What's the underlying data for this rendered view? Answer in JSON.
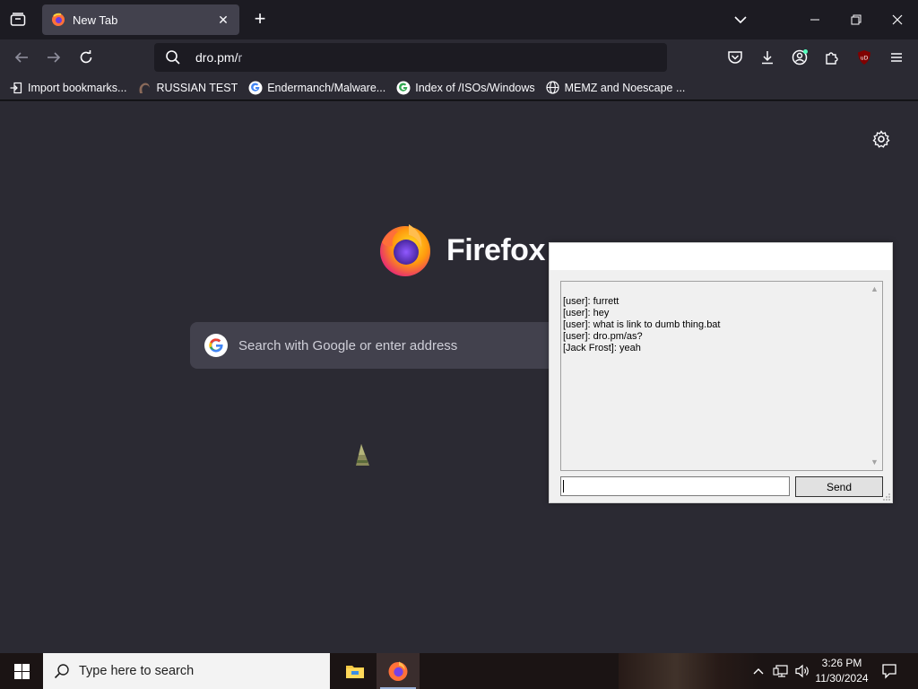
{
  "browser": {
    "tab": {
      "title": "New Tab"
    },
    "urlbar": {
      "value_host": "dro.pm/",
      "value_path": "r"
    },
    "bookmarks": [
      {
        "label": "Import bookmarks...",
        "icon": "import-icon"
      },
      {
        "label": "RUSSIAN TEST",
        "icon": "site-favicon"
      },
      {
        "label": "Endermanch/Malware...",
        "icon": "google-icon"
      },
      {
        "label": "Index of /ISOs/Windows",
        "icon": "google-icon"
      },
      {
        "label": "MEMZ and Noescape ...",
        "icon": "globe-icon"
      }
    ]
  },
  "newtab": {
    "wordmark": "Firefox",
    "search_placeholder": "Search with Google or enter address"
  },
  "chat": {
    "messages": [
      "[user]: furrett",
      "[user]: hey",
      "[user]: what is link to dumb thing.bat",
      "[user]: dro.pm/as?",
      "[Jack Frost]: yeah"
    ],
    "input_value": "",
    "send_label": "Send"
  },
  "taskbar": {
    "search_placeholder": "Type here to search",
    "time": "3:26 PM",
    "date": "11/30/2024"
  },
  "colors": {
    "accent_firefox": "#ff7139",
    "toolbar": "#2b2a33",
    "tabstrip": "#1c1b22"
  }
}
